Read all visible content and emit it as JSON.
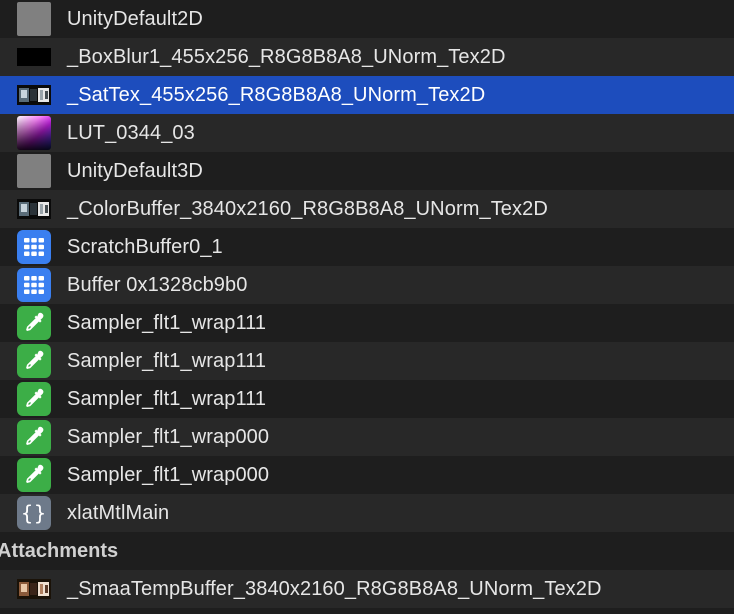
{
  "resources": [
    {
      "label": "UnityDefault2D",
      "icon": "gray-texture-thumbnail",
      "selected": false
    },
    {
      "label": "_BoxBlur1_455x256_R8G8B8A8_UNorm_Tex2D",
      "icon": "dark-blur-texture-thumbnail",
      "selected": false
    },
    {
      "label": "_SatTex_455x256_R8G8B8A8_UNorm_Tex2D",
      "icon": "scene-texture-thumbnail",
      "selected": true
    },
    {
      "label": "LUT_0344_03",
      "icon": "lut-gradient-thumbnail",
      "selected": false
    },
    {
      "label": "UnityDefault3D",
      "icon": "gray-texture-thumbnail",
      "selected": false
    },
    {
      "label": "_ColorBuffer_3840x2160_R8G8B8A8_UNorm_Tex2D",
      "icon": "scene-texture-thumbnail",
      "selected": false
    },
    {
      "label": "ScratchBuffer0_1",
      "icon": "buffer-grid-icon",
      "selected": false
    },
    {
      "label": "Buffer 0x1328cb9b0",
      "icon": "buffer-grid-icon",
      "selected": false
    },
    {
      "label": "Sampler_flt1_wrap111",
      "icon": "sampler-dropper-icon",
      "selected": false
    },
    {
      "label": "Sampler_flt1_wrap111",
      "icon": "sampler-dropper-icon",
      "selected": false
    },
    {
      "label": "Sampler_flt1_wrap111",
      "icon": "sampler-dropper-icon",
      "selected": false
    },
    {
      "label": "Sampler_flt1_wrap000",
      "icon": "sampler-dropper-icon",
      "selected": false
    },
    {
      "label": "Sampler_flt1_wrap000",
      "icon": "sampler-dropper-icon",
      "selected": false
    },
    {
      "label": "xlatMtlMain",
      "icon": "function-braces-icon",
      "selected": false
    }
  ],
  "attachments_section": {
    "title": "Attachments",
    "items": [
      {
        "label": "_SmaaTempBuffer_3840x2160_R8G8B8A8_UNorm_Tex2D",
        "icon": "scene-texture-thumbnail",
        "selected": false
      }
    ]
  },
  "colors": {
    "background": "#1e1e1e",
    "row_alternate": "#282828",
    "selection": "#1d4dbd",
    "text": "#e6e6e6",
    "buffer_icon": "#3a7ff0",
    "sampler_icon": "#3cae47",
    "function_icon": "#6e7a8a"
  }
}
